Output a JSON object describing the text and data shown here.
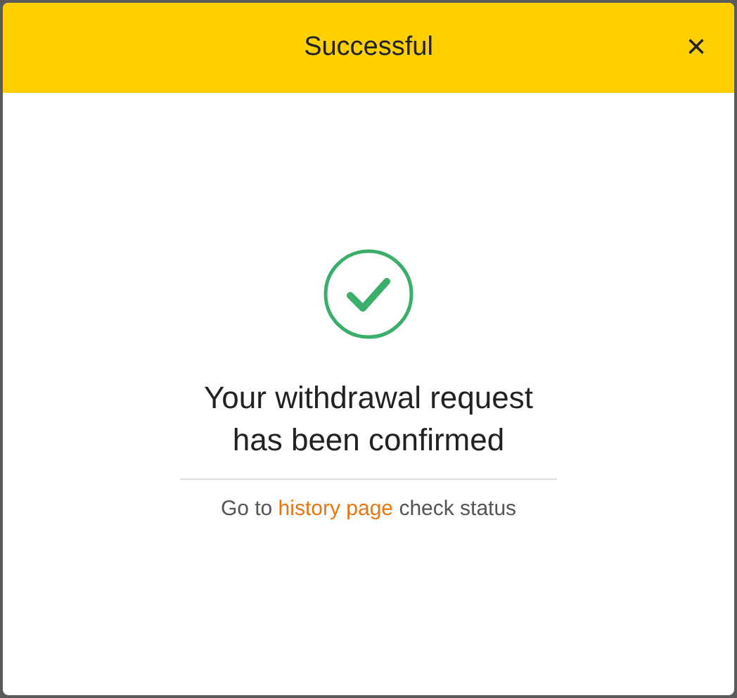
{
  "dialog": {
    "title": "Successful",
    "close": "×"
  },
  "message": [
    "Your withdrawal request",
    "has been confirmed"
  ],
  "footer": {
    "before": "Go to",
    "link": "history page",
    "after": "check status"
  }
}
